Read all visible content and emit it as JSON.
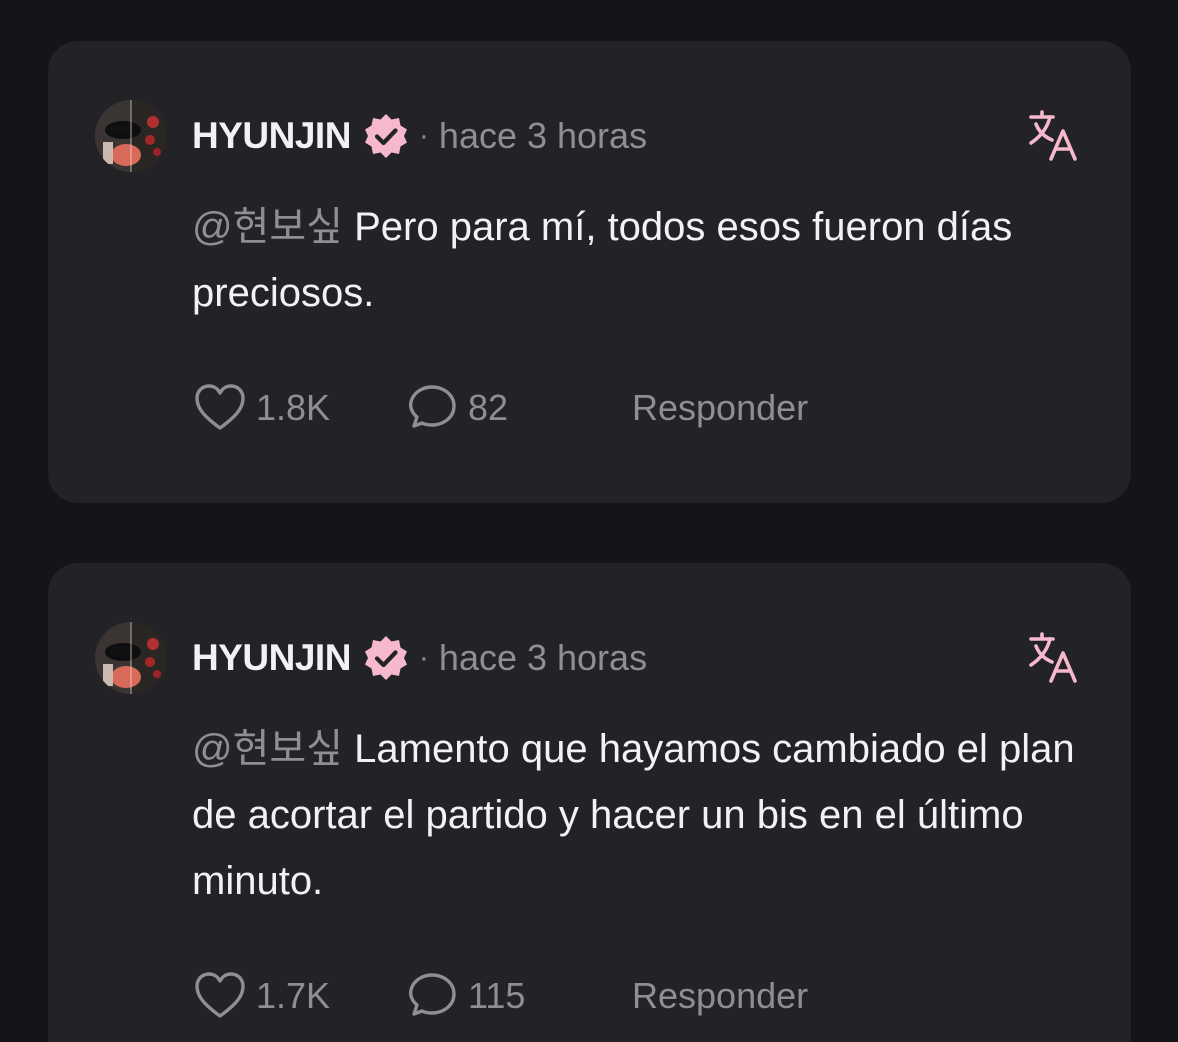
{
  "colors": {
    "background": "#141419",
    "card": "#222227",
    "accent_pink": "#f6b8cc",
    "text_primary": "#f2f2f4",
    "text_secondary": "#8e8e95"
  },
  "posts": [
    {
      "username": "HYUNJIN",
      "verified_icon": "verified-badge-icon",
      "separator": "·",
      "time": "hace 3 horas",
      "translate_icon": "translate-icon",
      "mention": "@현보싶",
      "text": " Pero para mí, todos esos fueron días preciosos.",
      "likes": "1.8K",
      "comments": "82",
      "reply_label": "Responder"
    },
    {
      "username": "HYUNJIN",
      "verified_icon": "verified-badge-icon",
      "separator": "·",
      "time": "hace 3 horas",
      "translate_icon": "translate-icon",
      "mention": "@현보싶",
      "text": " Lamento que hayamos cambiado el plan de acortar el partido y hacer un bis en el último minuto.",
      "likes": "1.7K",
      "comments": "115",
      "reply_label": "Responder"
    }
  ]
}
